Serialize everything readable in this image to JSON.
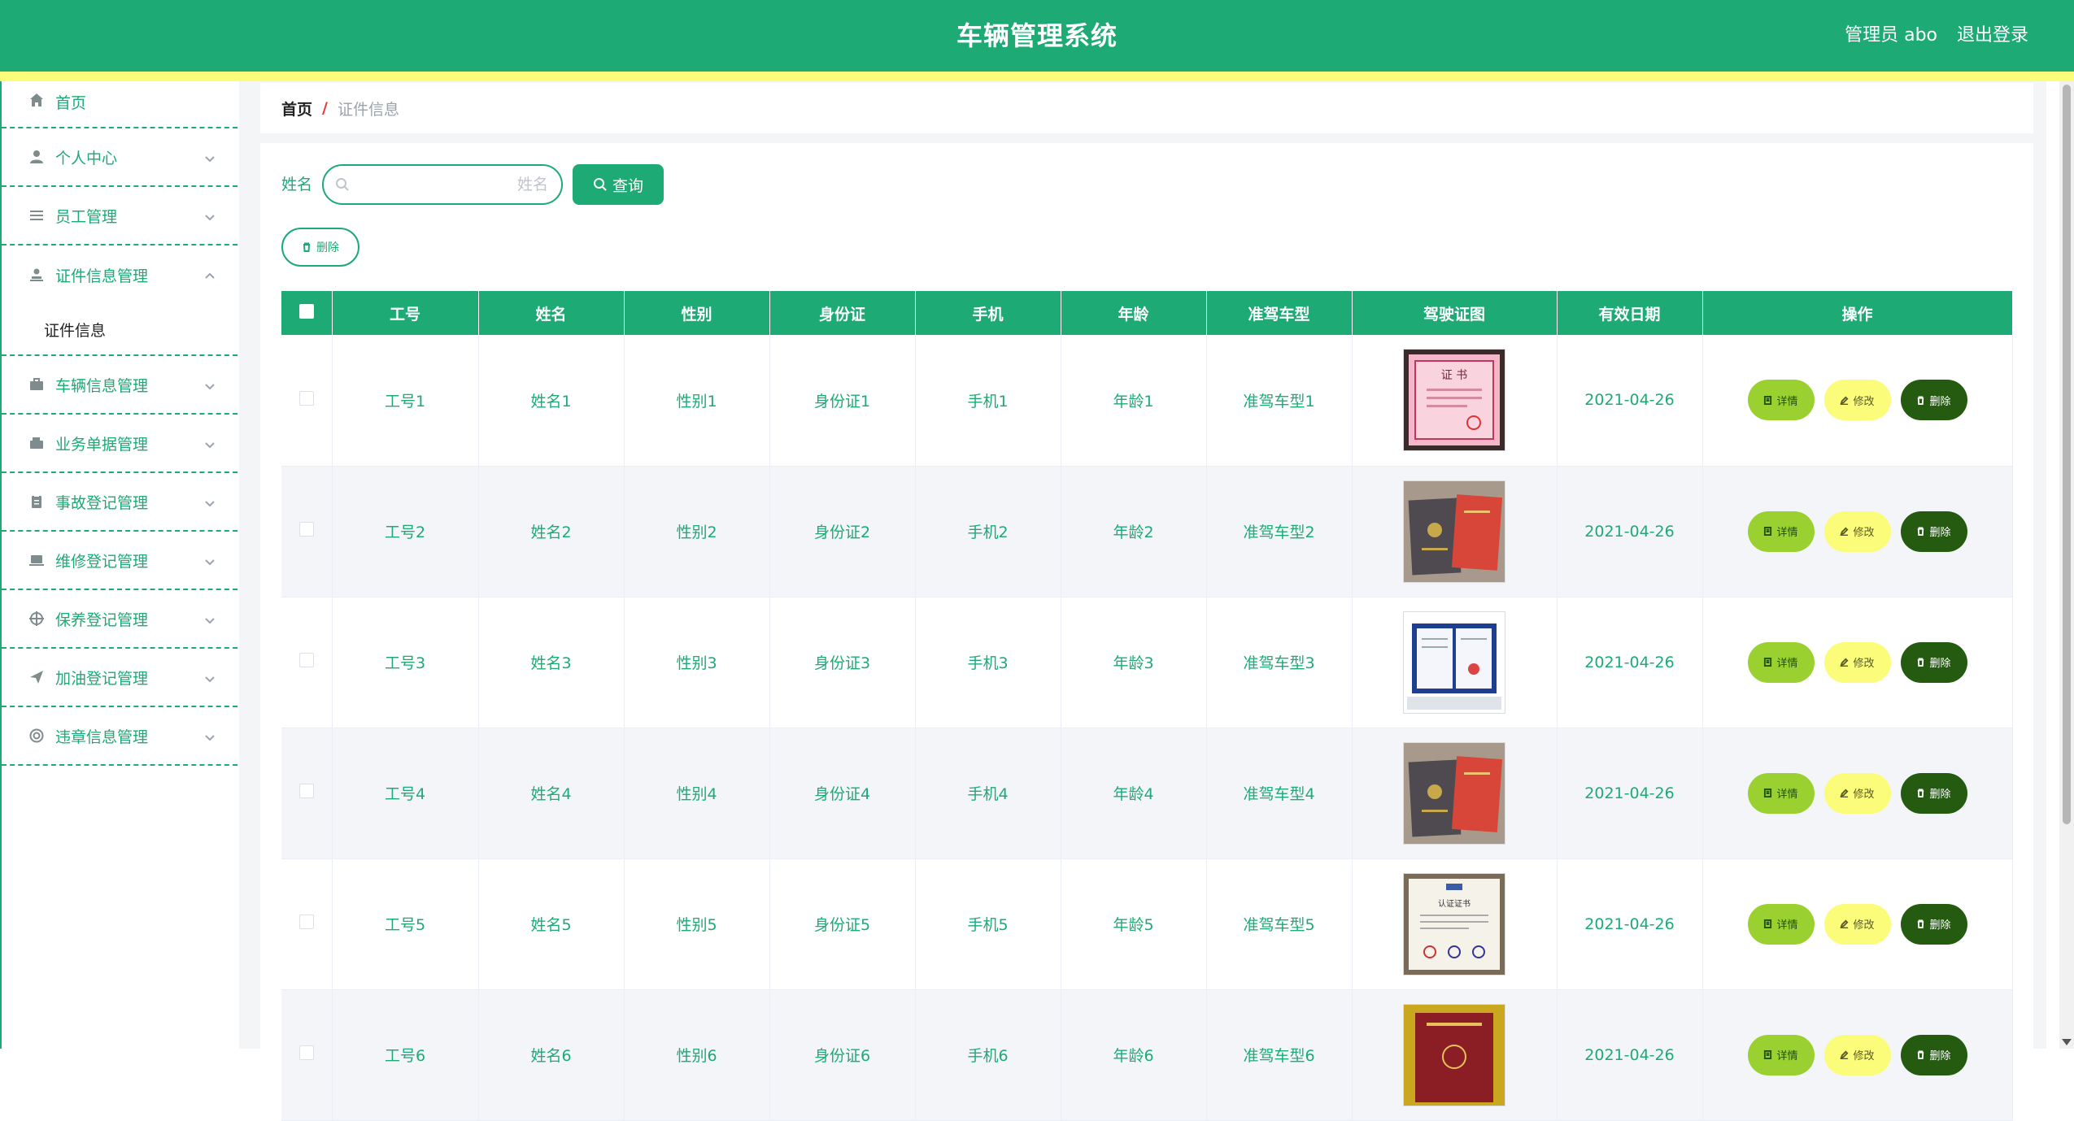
{
  "header": {
    "title": "车辆管理系统",
    "user_label": "管理员 abo",
    "logout_label": "退出登录"
  },
  "sidebar": {
    "items": [
      {
        "label": "首页",
        "icon": "home-icon",
        "expanded": null
      },
      {
        "label": "个人中心",
        "icon": "user-icon",
        "expanded": false
      },
      {
        "label": "员工管理",
        "icon": "list-icon",
        "expanded": false
      },
      {
        "label": "证件信息管理",
        "icon": "user-stamp-icon",
        "expanded": true,
        "children": [
          {
            "label": "证件信息"
          }
        ]
      },
      {
        "label": "车辆信息管理",
        "icon": "briefcase-icon",
        "expanded": false
      },
      {
        "label": "业务单据管理",
        "icon": "wallet-icon",
        "expanded": false
      },
      {
        "label": "事故登记管理",
        "icon": "clipboard-icon",
        "expanded": false
      },
      {
        "label": "维修登记管理",
        "icon": "laptop-icon",
        "expanded": false
      },
      {
        "label": "保养登记管理",
        "icon": "target-icon",
        "expanded": false
      },
      {
        "label": "加油登记管理",
        "icon": "send-icon",
        "expanded": false
      },
      {
        "label": "违章信息管理",
        "icon": "lifebuoy-icon",
        "expanded": false
      }
    ]
  },
  "breadcrumb": {
    "home": "首页",
    "separator": "/",
    "current": "证件信息"
  },
  "search": {
    "label": "姓名",
    "placeholder": "姓名",
    "value": "",
    "query_label": "查询"
  },
  "actions": {
    "batch_delete_label": "删除"
  },
  "table": {
    "columns": [
      "工号",
      "姓名",
      "性别",
      "身份证",
      "手机",
      "年龄",
      "准驾车型",
      "驾驶证图",
      "有效日期",
      "操作"
    ],
    "rows": [
      {
        "id": "工号1",
        "name": "姓名1",
        "gender": "性别1",
        "idcard": "身份证1",
        "phone": "手机1",
        "age": "年龄1",
        "vehicle_type": "准驾车型1",
        "image": "pink-certificate",
        "date": "2021-04-26"
      },
      {
        "id": "工号2",
        "name": "姓名2",
        "gender": "性别2",
        "idcard": "身份证2",
        "phone": "手机2",
        "age": "年龄2",
        "vehicle_type": "准驾车型2",
        "image": "grey-red-booklets",
        "date": "2021-04-26"
      },
      {
        "id": "工号3",
        "name": "姓名3",
        "gender": "性别3",
        "idcard": "身份证3",
        "phone": "手机3",
        "age": "年龄3",
        "vehicle_type": "准驾车型3",
        "image": "blue-folder-certificate",
        "date": "2021-04-26"
      },
      {
        "id": "工号4",
        "name": "姓名4",
        "gender": "性别4",
        "idcard": "身份证4",
        "phone": "手机4",
        "age": "年龄4",
        "vehicle_type": "准驾车型4",
        "image": "grey-red-booklets",
        "date": "2021-04-26"
      },
      {
        "id": "工号5",
        "name": "姓名5",
        "gender": "性别5",
        "idcard": "身份证5",
        "phone": "手机5",
        "age": "年龄5",
        "vehicle_type": "准驾车型5",
        "image": "framed-certificate",
        "date": "2021-04-26"
      },
      {
        "id": "工号6",
        "name": "姓名6",
        "gender": "性别6",
        "idcard": "身份证6",
        "phone": "手机6",
        "age": "年龄6",
        "vehicle_type": "准驾车型6",
        "image": "red-cover-booklet",
        "date": "2021-04-26"
      }
    ],
    "row_actions": {
      "detail": "详情",
      "edit": "修改",
      "delete": "删除"
    }
  },
  "colors": {
    "primary": "#1daa75",
    "accent_strip": "#fbfc79",
    "detail_button": "#9ad130",
    "edit_button": "#fbfc79",
    "delete_button": "#245b10"
  }
}
